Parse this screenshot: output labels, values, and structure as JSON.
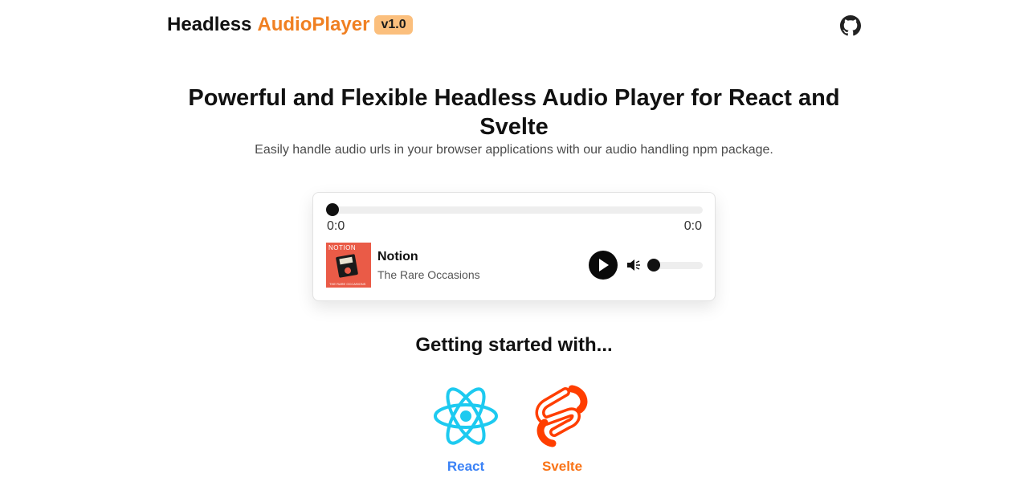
{
  "header": {
    "brand_primary": "Headless",
    "brand_accent": "AudioPlayer",
    "version_badge": "v1.0",
    "github_icon": "github-icon"
  },
  "hero": {
    "title": "Powerful and Flexible Headless Audio Player for React and Svelte",
    "subtitle": "Easily handle audio urls in your browser applications with our audio handling npm package."
  },
  "player": {
    "progress": 0,
    "current_time": "0:0",
    "duration": "0:0",
    "track_title": "Notion",
    "track_artist": "The Rare Occasions",
    "cover_text": "NOTION",
    "cover_footer": "THE RARE OCCASIONS",
    "volume": 0,
    "icons": [
      "play-icon",
      "volume-icon"
    ]
  },
  "getting_started": {
    "title": "Getting started with...",
    "frameworks": [
      {
        "label": "React",
        "icon": "react-icon",
        "color": "#3b82f6"
      },
      {
        "label": "Svelte",
        "icon": "svelte-icon",
        "color": "#f97316"
      }
    ]
  },
  "colors": {
    "accent": "#f08022",
    "badge_bg": "#fbbf7d",
    "react_logo": "#1dcaf0",
    "svelte_logo": "#ff3e00"
  }
}
